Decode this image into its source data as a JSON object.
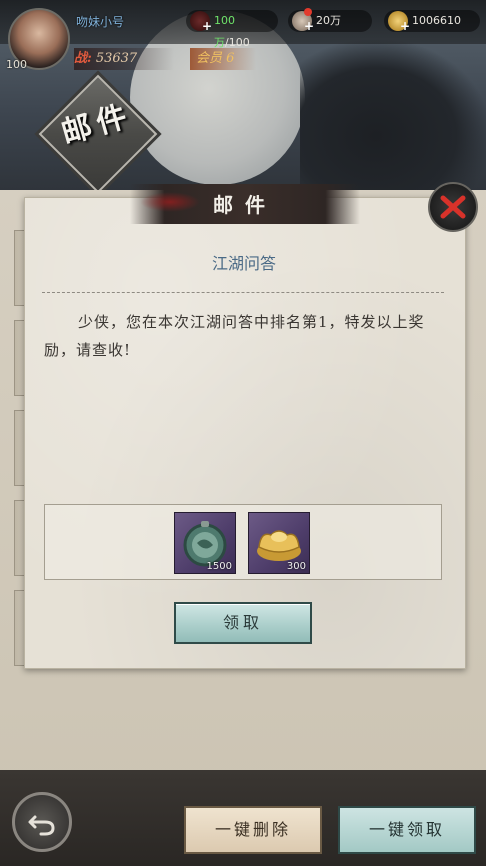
{
  "header": {
    "player_level": "100",
    "player_name": "吻妹小号",
    "power_label": "战:",
    "power_value": "53637",
    "vip_label": "会员 6",
    "page_title": "邮件",
    "currencies": {
      "energy_current": "100万",
      "energy_max": "/100",
      "silver": "20万",
      "gold": "1006610"
    }
  },
  "dialog": {
    "title": "邮件",
    "mail_title": "江湖问答",
    "mail_body": "少侠，您在本次江湖问答中排名第1，特发以上奖励，请查收!",
    "rewards": [
      {
        "icon": "jade-medal-icon",
        "quantity": "1500"
      },
      {
        "icon": "gold-ingot-icon",
        "quantity": "300"
      }
    ],
    "claim_label": "领取"
  },
  "bottom": {
    "delete_all_label": "一键删除",
    "claim_all_label": "一键领取"
  },
  "colors": {
    "accent_teal": "#a9cdc9",
    "paper": "#e6e1d6",
    "close_red": "#d8322a",
    "energy_green": "#6fe36a"
  }
}
